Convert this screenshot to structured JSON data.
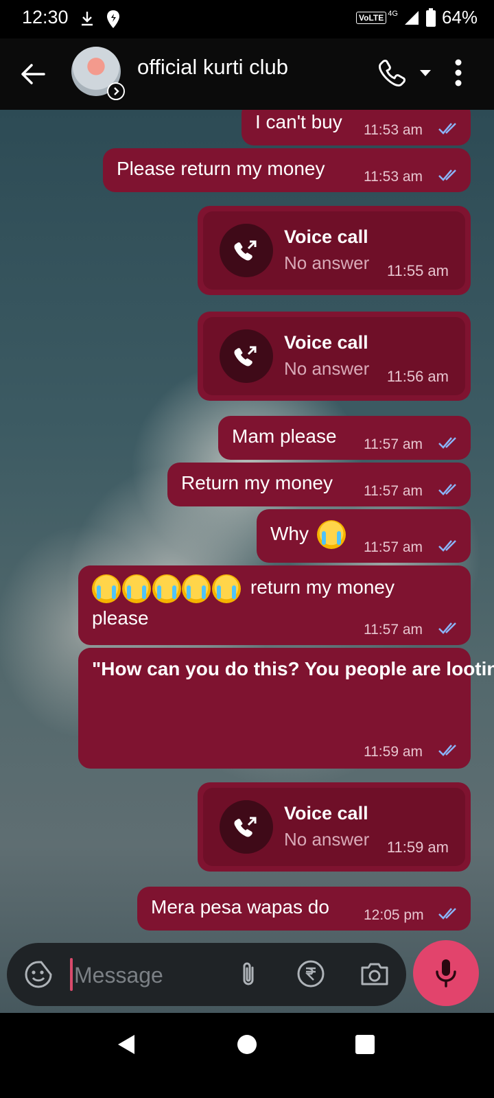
{
  "status": {
    "time": "12:30",
    "network_label": "VoLTE",
    "signal_label": "4G",
    "battery": "64%",
    "icons": [
      "download-icon",
      "location-icon",
      "signal-icon",
      "battery-icon"
    ]
  },
  "header": {
    "contact_name": "official kurti club",
    "icons": [
      "back-arrow-icon",
      "avatar",
      "phone-icon",
      "dropdown-icon",
      "more-vert-icon"
    ]
  },
  "messages": [
    {
      "type": "text",
      "text": "I can't buy",
      "time": "11:53 am"
    },
    {
      "type": "text",
      "text": "Please return my money",
      "time": "11:53 am"
    },
    {
      "type": "call",
      "title": "Voice call",
      "status": "No answer",
      "time": "11:55 am"
    },
    {
      "type": "call",
      "title": "Voice call",
      "status": "No answer",
      "time": "11:56 am"
    },
    {
      "type": "text",
      "text": "Mam please",
      "time": "11:57 am"
    },
    {
      "type": "text",
      "text": "Return my money",
      "time": "11:57 am"
    },
    {
      "type": "text",
      "text": "Why",
      "time": "11:57 am",
      "emoji": "loudly-crying-face"
    },
    {
      "type": "text",
      "text_line1": "return my money",
      "text_line2": "please",
      "time": "11:57 am",
      "emoji": "loudly-crying-face",
      "emoji_count": 5
    },
    {
      "type": "text",
      "text": "\"How can you do this? You people are looting the poor. This is fraud. I will file a complaint with the police against this number.\"",
      "time": "11:59 am"
    },
    {
      "type": "call",
      "title": "Voice call",
      "status": "No answer",
      "time": "11:59 am"
    },
    {
      "type": "text",
      "text": "Mera pesa wapas do",
      "time": "12:05 pm"
    }
  ],
  "composer": {
    "placeholder": "Message",
    "icons": [
      "sticker-icon",
      "attach-icon",
      "rupee-icon",
      "camera-icon",
      "mic-icon"
    ]
  },
  "navigation": {
    "icons": [
      "nav-back-icon",
      "nav-home-icon",
      "nav-recents-icon"
    ]
  },
  "colors": {
    "bubble": "#7f1330",
    "call_inner": "#6f0f28",
    "mic_button": "#e2446c",
    "read_ticks": "#8ab4f8"
  }
}
